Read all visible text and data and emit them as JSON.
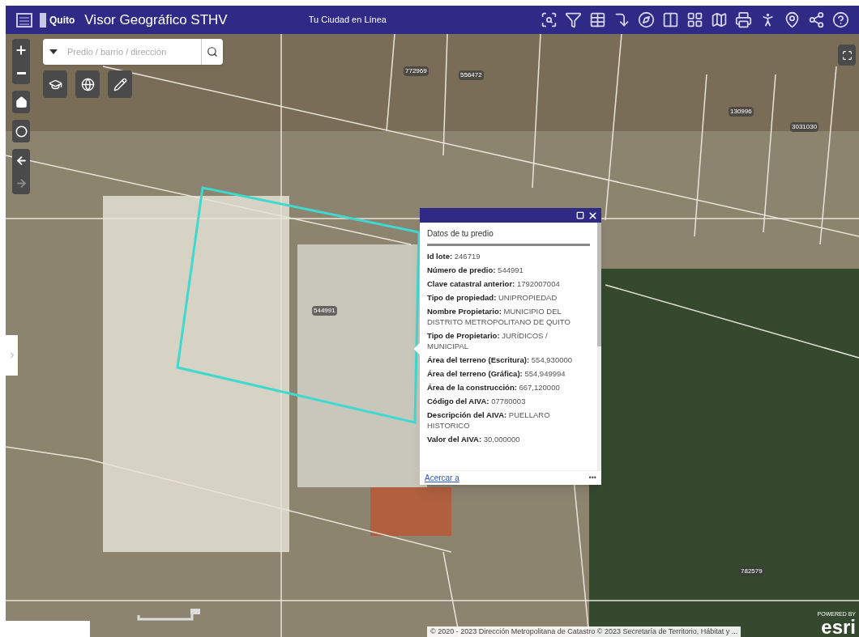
{
  "header": {
    "title": "Visor Geográfico STHV",
    "logo_text": "Quito",
    "subtitle": "Tu Ciudad en Línea"
  },
  "search": {
    "placeholder": "Predio / barrio / dirección"
  },
  "navigation": {
    "back_disabled": false,
    "forward_disabled": true
  },
  "parcel_labels": [
    {
      "text": "772969"
    },
    {
      "text": "556472"
    },
    {
      "text": "130996"
    },
    {
      "text": "3031030"
    },
    {
      "text": "544991"
    },
    {
      "text": "782579"
    }
  ],
  "popup": {
    "title": "Datos de tu predio",
    "fields": [
      {
        "label": "Id lote:",
        "value": "246719"
      },
      {
        "label": "Número de predio:",
        "value": "544991"
      },
      {
        "label": "Clave catastral anterior:",
        "value": "1792007004"
      },
      {
        "label": "Tipo de propiedad:",
        "value": "UNIPROPIEDAD"
      },
      {
        "label": "Nombre Propietario:",
        "value": "MUNICIPIO DEL DISTRITO METROPOLITANO DE QUITO"
      },
      {
        "label": "Tipo de Propietario:",
        "value": "JURÍDICOS / MUNICIPAL"
      },
      {
        "label": "Área del terreno (Escritura):",
        "value": "554,930000"
      },
      {
        "label": "Área del terreno (Gráfica):",
        "value": "554,949994"
      },
      {
        "label": "Área de la construcción:",
        "value": "667,120000"
      },
      {
        "label": "Código del AIVA:",
        "value": "07780003"
      },
      {
        "label": "Descripción del AIVA:",
        "value": "PUELLARO HISTORICO"
      },
      {
        "label": "Valor del AIVA:",
        "value": "30,000000"
      }
    ],
    "zoom_link": "Acercar a",
    "menu": "•••"
  },
  "attribution": "© 2020 - 2023 Dirección Metropolitana de Catastro © 2023 Secretaría de Territorio, Hábitat y ...",
  "esri": {
    "powered": "POWERED BY",
    "logo": "esri"
  }
}
